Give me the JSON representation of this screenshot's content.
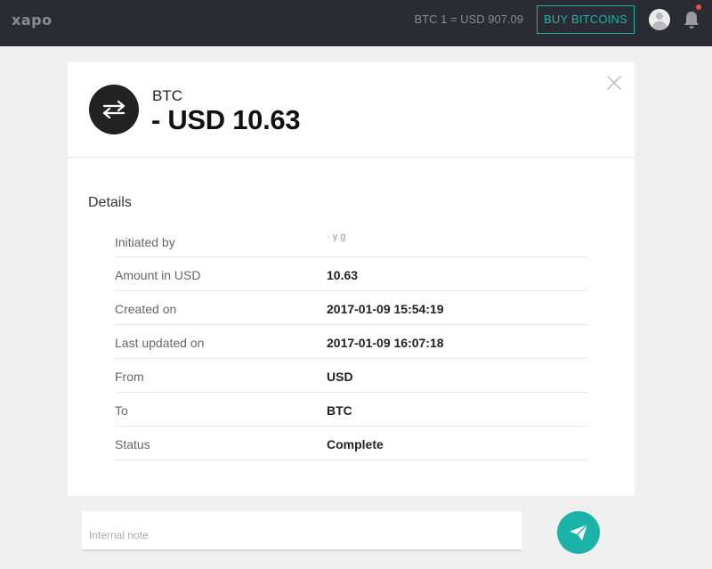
{
  "topbar": {
    "logo": "xapo",
    "rate": "BTC 1 = USD 907.09",
    "buy_label": "BUY BITCOINS",
    "avatar_icon": "user-avatar-icon",
    "bell_icon": "bell-icon",
    "notification_color": "#e84c3d"
  },
  "transaction": {
    "icon": "exchange-arrows-icon",
    "currency": "BTC",
    "amount": "- USD 10.63",
    "close_icon": "close-icon"
  },
  "details": {
    "title": "Details",
    "rows": [
      {
        "label": "Initiated by",
        "value": "· y g"
      },
      {
        "label": "Amount in USD",
        "value": "10.63"
      },
      {
        "label": "Created on",
        "value": "2017-01-09 15:54:19"
      },
      {
        "label": "Last updated on",
        "value": "2017-01-09 16:07:18"
      },
      {
        "label": "From",
        "value": "USD"
      },
      {
        "label": "To",
        "value": "BTC"
      },
      {
        "label": "Status",
        "value": "Complete"
      }
    ]
  },
  "footer": {
    "note_placeholder": "Internal note",
    "note_value": "",
    "send_icon": "send-paper-plane-icon"
  },
  "colors": {
    "accent": "#1bb3a7",
    "topbar": "#2b2b33",
    "background": "#f0f0f0"
  }
}
